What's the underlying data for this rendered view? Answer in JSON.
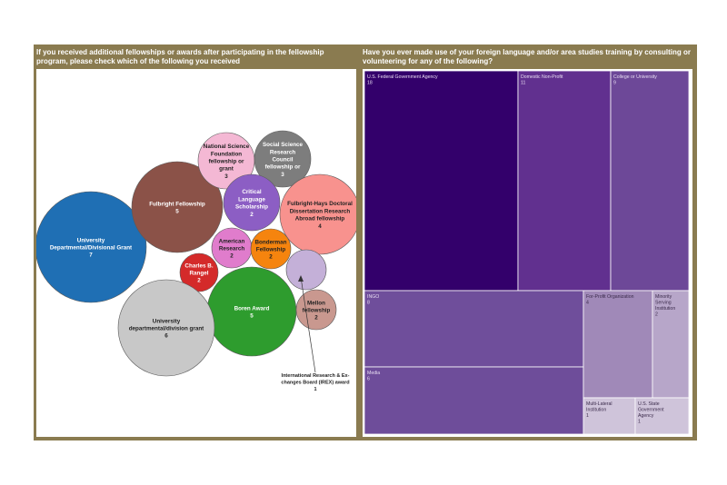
{
  "chart_data": [
    {
      "type": "bubble",
      "title": "If you received additional fellowships or awards after participating in the fellowship program, please check which of the following you received",
      "items": [
        {
          "label": "University Departmental/Divisional Grant",
          "value": 7,
          "color": "#1f6fb4"
        },
        {
          "label": "Fulbright Fellowship",
          "value": 5,
          "color": "#8b5248"
        },
        {
          "label": "National Science Foundation fellowship or grant",
          "value": 3,
          "color": "#f4b8d4"
        },
        {
          "label": "Social Science Research Council fellowship or",
          "value": 3,
          "color": "#7d7d7d"
        },
        {
          "label": "Critical Language Scholarship",
          "value": 2,
          "color": "#8c5ec4"
        },
        {
          "label": "Fulbright-Hays Doctoral Dissertation Research Abroad fellowship",
          "value": 4,
          "color": "#f8928e"
        },
        {
          "label": "American Research",
          "value": 2,
          "color": "#e07ccc"
        },
        {
          "label": "Bonderman Fellowship",
          "value": 2,
          "color": "#f5840e"
        },
        {
          "label": "Charles B. Rangel",
          "value": 2,
          "color": "#d42a2a"
        },
        {
          "label": "Boren Award",
          "value": 5,
          "color": "#2e9c2e"
        },
        {
          "label": "University departmental/division grant",
          "value": 6,
          "color": "#c8c8c8"
        },
        {
          "label": "Mellon fellowship",
          "value": 2,
          "color": "#c9988f"
        },
        {
          "label": "International Research & Exchanges Board (IREX) award",
          "value": 1,
          "color": "#c4b0d8"
        }
      ]
    },
    {
      "type": "treemap",
      "title": "Have you ever made use of your foreign language and/or area studies training by consulting or volunteering for any of the following?",
      "items": [
        {
          "label": "U.S. Federal Government Agency",
          "value": 18,
          "color": "#33006b"
        },
        {
          "label": "Domestic Non-Profit",
          "value": 11,
          "color": "#61308f"
        },
        {
          "label": "College or University",
          "value": 9,
          "color": "#6d4898"
        },
        {
          "label": "INGO",
          "value": 8,
          "color": "#6f4e9b"
        },
        {
          "label": "Media",
          "value": 6,
          "color": "#6e4d9a"
        },
        {
          "label": "For-Profit Organization",
          "value": 4,
          "color": "#a089b8"
        },
        {
          "label": "Minority Serving Institution",
          "value": 2,
          "color": "#b7a6c9"
        },
        {
          "label": "Multi-Lateral Institution",
          "value": 1,
          "color": "#cfc4da"
        },
        {
          "label": "U.S. State Government Agency",
          "value": 1,
          "color": "#cfc4da"
        }
      ]
    }
  ]
}
